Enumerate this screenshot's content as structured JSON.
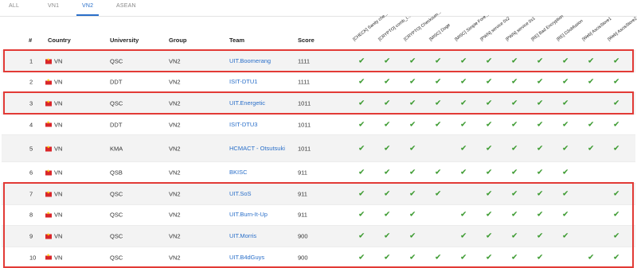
{
  "tabs": [
    {
      "label": "ALL",
      "active": false
    },
    {
      "label": "VN1",
      "active": false
    },
    {
      "label": "VN2",
      "active": true
    },
    {
      "label": "ASEAN",
      "active": false
    }
  ],
  "columns": {
    "rank": "#",
    "country": "Country",
    "university": "University",
    "group": "Group",
    "team": "Team",
    "score": "Score"
  },
  "challenges": [
    "[CHECK] Sanity che...",
    "[CRYPTO] comb_i...",
    "[CRYPTO] Checksum...",
    "[MISC] Doge",
    "[MISC] Simple Fore...",
    "[PWN] service 0x2",
    "[PWN] service 0x1",
    "[RE] Bad Encryption",
    "[RE] D3obfusion",
    "[Web] AscisStore1",
    "[Web] AscisStore2"
  ],
  "rows": [
    {
      "rank": "1",
      "country": "VN",
      "university": "QSC",
      "group": "VN2",
      "team": "UIT.Boomerang",
      "score": "1111",
      "solved": [
        1,
        1,
        1,
        1,
        1,
        1,
        1,
        1,
        1,
        1,
        1
      ],
      "highlight": true
    },
    {
      "rank": "2",
      "country": "VN",
      "university": "DDT",
      "group": "VN2",
      "team": "ISIT-DTU1",
      "score": "1111",
      "solved": [
        1,
        1,
        1,
        1,
        1,
        1,
        1,
        1,
        1,
        1,
        1
      ],
      "highlight": false
    },
    {
      "rank": "3",
      "country": "VN",
      "university": "QSC",
      "group": "VN2",
      "team": "UIT.Energetic",
      "score": "1011",
      "solved": [
        1,
        1,
        1,
        1,
        1,
        1,
        1,
        1,
        1,
        0,
        1
      ],
      "highlight": true
    },
    {
      "rank": "4",
      "country": "VN",
      "university": "DDT",
      "group": "VN2",
      "team": "ISIT-DTU3",
      "score": "1011",
      "solved": [
        1,
        1,
        1,
        1,
        1,
        1,
        1,
        1,
        1,
        1,
        1
      ],
      "highlight": false
    },
    {
      "rank": "5",
      "country": "VN",
      "university": "KMA",
      "group": "VN2",
      "team": "HCMACT - Otsutsuki",
      "score": "1011",
      "solved": [
        1,
        1,
        1,
        0,
        1,
        1,
        1,
        1,
        1,
        1,
        1
      ],
      "highlight": false
    },
    {
      "rank": "6",
      "country": "VN",
      "university": "QSB",
      "group": "VN2",
      "team": "BKISC",
      "score": "911",
      "solved": [
        1,
        1,
        1,
        1,
        1,
        1,
        1,
        1,
        1,
        0,
        0
      ],
      "highlight": false
    },
    {
      "rank": "7",
      "country": "VN",
      "university": "QSC",
      "group": "VN2",
      "team": "UIT.SoS",
      "score": "911",
      "solved": [
        1,
        1,
        1,
        1,
        0,
        1,
        1,
        1,
        1,
        0,
        1
      ],
      "highlight": true
    },
    {
      "rank": "8",
      "country": "VN",
      "university": "QSC",
      "group": "VN2",
      "team": "UIT.Burn-It-Up",
      "score": "911",
      "solved": [
        1,
        1,
        1,
        0,
        1,
        1,
        1,
        1,
        1,
        0,
        1
      ],
      "highlight": true
    },
    {
      "rank": "9",
      "country": "VN",
      "university": "QSC",
      "group": "VN2",
      "team": "UIT.Morris",
      "score": "900",
      "solved": [
        1,
        1,
        1,
        0,
        1,
        1,
        1,
        1,
        1,
        0,
        1
      ],
      "highlight": true
    },
    {
      "rank": "10",
      "country": "VN",
      "university": "QSC",
      "group": "VN2",
      "team": "UIT.B4dGuys",
      "score": "900",
      "solved": [
        1,
        1,
        1,
        1,
        1,
        1,
        1,
        1,
        0,
        1,
        1
      ],
      "highlight": true
    }
  ],
  "colors": {
    "accent": "#2a6fc9",
    "check": "#3b9a2f",
    "highlight": "#e23a36"
  },
  "icons": {
    "check": "check-icon",
    "flag": "vietnam-flag-icon"
  }
}
